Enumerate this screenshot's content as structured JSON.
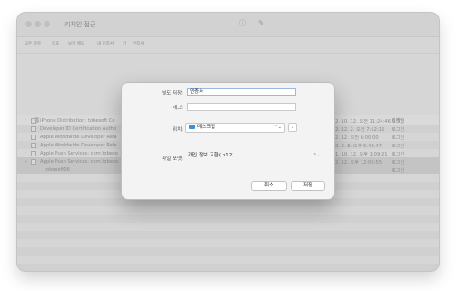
{
  "window": {
    "title": "키체인 접근",
    "toolbar_icons": [
      "info-icon",
      "edit-icon"
    ]
  },
  "filter_tabs": [
    "모든 항목",
    "암호",
    "보안 메모",
    "내 인증서",
    "키",
    "인증서"
  ],
  "list": {
    "columns": {
      "name": "이름",
      "keychain": "키체인"
    },
    "rows": [
      {
        "name": "iPhone Distribution: tobesoft Co",
        "date": "2. 10. 12. 오전 11:24:46",
        "keychain": "로그인"
      },
      {
        "name": "Developer ID Certification Autho",
        "date": "2. 12. 2. 오전 7:12:15",
        "keychain": "로그인"
      },
      {
        "name": "Apple Worldwide Developer Rela",
        "date": "2. 12. 오전 6:00:00",
        "keychain": "로그인"
      },
      {
        "name": "Apple Worldwide Developer Rela",
        "date": "2. 2. 8. 오후 6:48:47",
        "keychain": "로그인"
      },
      {
        "name": "Apple Push Services: com.tobeso",
        "date": "1. 10. 12. 오후 1:09:21",
        "keychain": "로그인"
      },
      {
        "name": "Apple Push Services: com.tobeso",
        "date": "2. 12. 오후 12:00:55",
        "keychain": "로그인"
      },
      {
        "name": "tobesoft06",
        "date": "",
        "keychain": "로그인"
      }
    ]
  },
  "dialog": {
    "save_as_label": "별도 저장:",
    "save_as_value": "인증서",
    "tags_label": "태그:",
    "tags_value": "",
    "where_label": "위치:",
    "where_value": "데스크탑",
    "format_label": "파일 포맷:",
    "format_value": "개인 정보 교환(.p12)",
    "cancel_label": "취소",
    "save_label": "저장",
    "accent_color": "#3b8fe0"
  }
}
